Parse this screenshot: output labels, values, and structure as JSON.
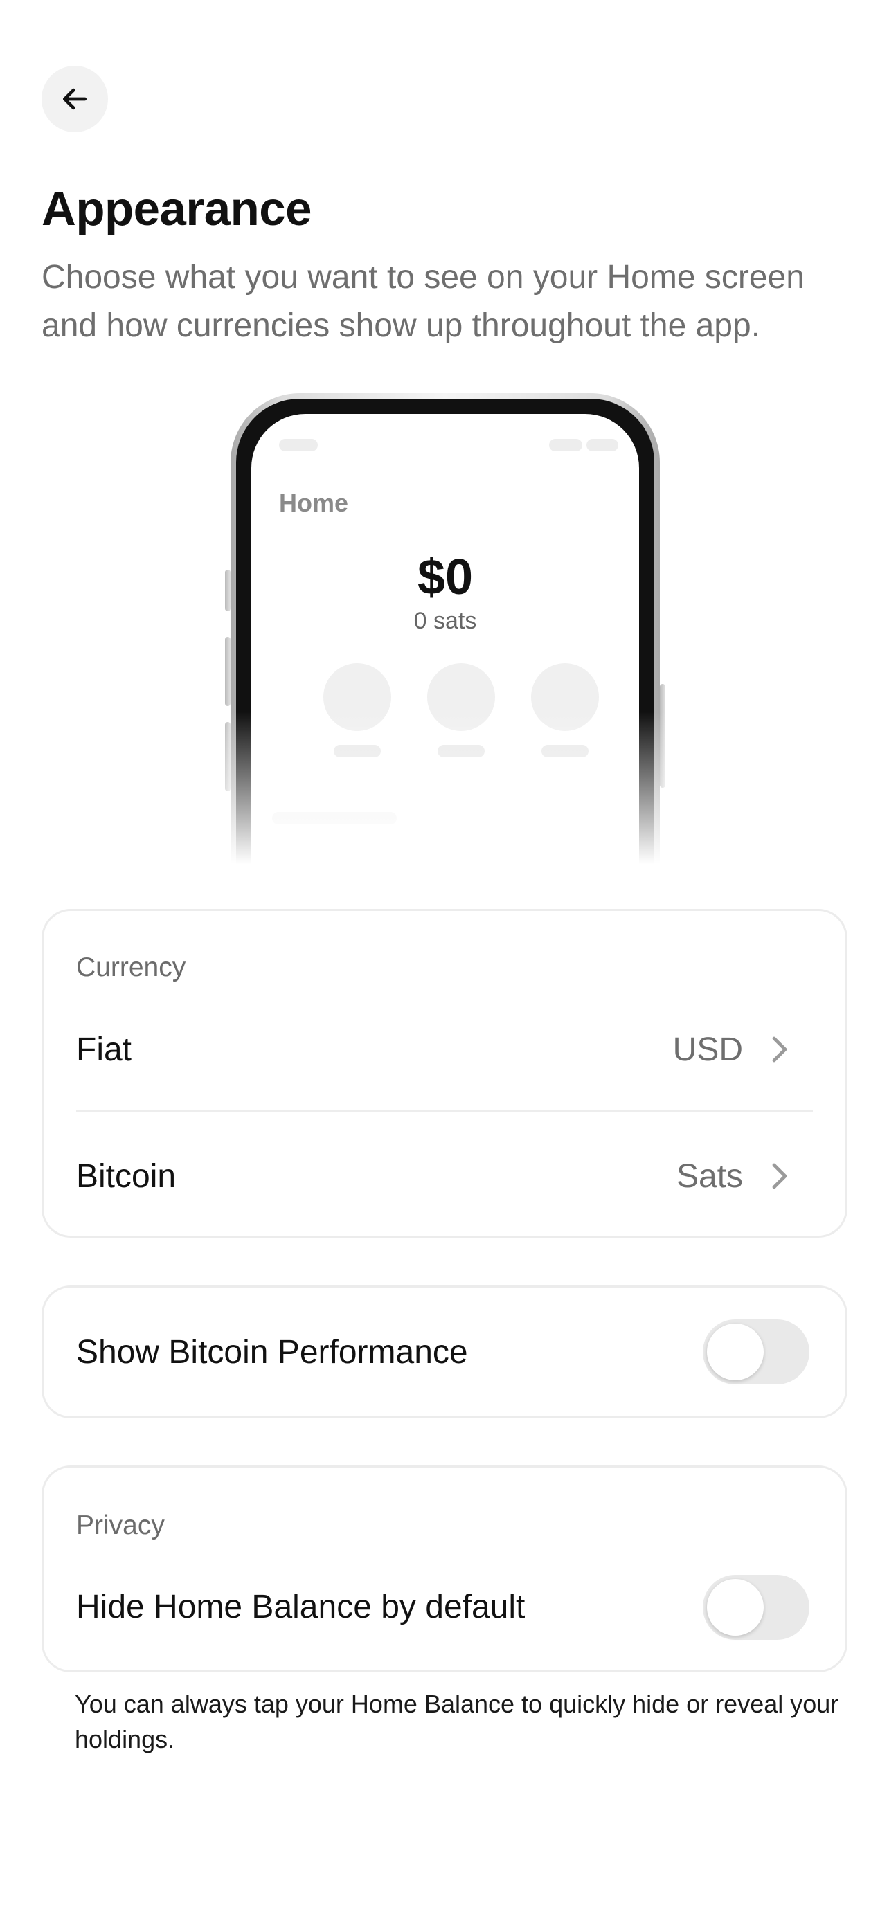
{
  "header": {
    "back_icon": "arrow-left-icon",
    "title": "Appearance",
    "subtitle": "Choose what you want to see on your Home screen and how currencies show up throughout the app."
  },
  "preview": {
    "screen_title": "Home",
    "amount": "$0",
    "sats": "0 sats"
  },
  "currency": {
    "section_label": "Currency",
    "rows": [
      {
        "label": "Fiat",
        "value": "USD",
        "icon": "chevron-right-icon"
      },
      {
        "label": "Bitcoin",
        "value": "Sats",
        "icon": "chevron-right-icon"
      }
    ]
  },
  "performance": {
    "label": "Show Bitcoin Performance",
    "enabled": false
  },
  "privacy": {
    "section_label": "Privacy",
    "label": "Hide Home Balance by default",
    "enabled": false,
    "footnote": "You can always tap your Home Balance to quickly hide or reveal your holdings."
  },
  "colors": {
    "background": "#ffffff",
    "text_primary": "#111111",
    "text_secondary": "#6e6e6e",
    "card_border": "#ececec",
    "toggle_off": "#e9e9e9"
  }
}
